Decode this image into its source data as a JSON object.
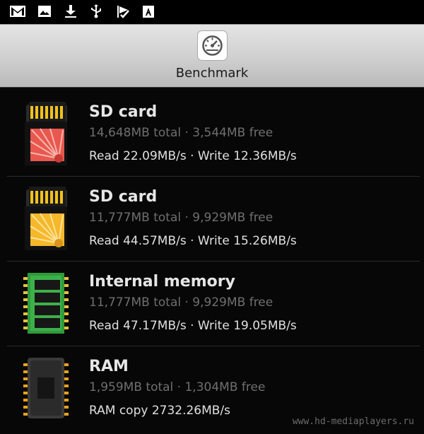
{
  "status_bar": {
    "icons": [
      "gmail-icon",
      "image-icon",
      "download-icon",
      "usb-icon",
      "check-flag-icon",
      "text-a-icon"
    ]
  },
  "header": {
    "title": "Benchmark",
    "icon": "speedometer-icon"
  },
  "items": [
    {
      "icon": "sd-card-red-icon",
      "title": "SD card",
      "capacity": "14,648MB total · 3,544MB free",
      "speed": "Read 22.09MB/s · Write 12.36MB/s"
    },
    {
      "icon": "sd-card-yellow-icon",
      "title": "SD card",
      "capacity": "11,777MB total · 9,929MB free",
      "speed": "Read 44.57MB/s · Write 15.26MB/s"
    },
    {
      "icon": "internal-memory-icon",
      "title": "Internal memory",
      "capacity": "11,777MB total · 9,929MB free",
      "speed": "Read 47.17MB/s · Write 19.05MB/s"
    },
    {
      "icon": "ram-chip-icon",
      "title": "RAM",
      "capacity": "1,959MB total · 1,304MB free",
      "speed": "RAM copy 2732.26MB/s"
    }
  ],
  "watermark": "www.hd-mediaplayers.ru",
  "colors": {
    "background": "#070707",
    "title": "#e6e6e6",
    "subtitle": "#6f6f6f",
    "speed": "#e0e0e0",
    "header_bg": "#d4d4d4"
  }
}
